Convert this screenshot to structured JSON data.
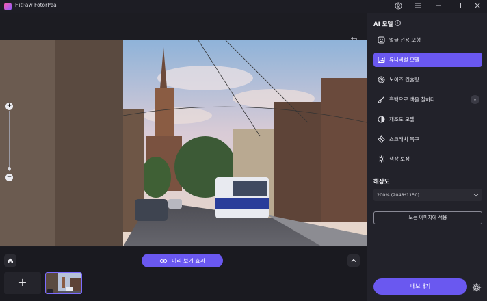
{
  "app": {
    "title": "HitPaw FotorPea"
  },
  "panel": {
    "title": "AI 모델",
    "models": [
      {
        "label": "얼굴 전용 모형",
        "icon": "face-icon",
        "active": false
      },
      {
        "label": "유니버설 모델",
        "icon": "image-icon",
        "active": true
      },
      {
        "label": "노이즈 컨슐링",
        "icon": "denoise-icon",
        "active": false
      },
      {
        "label": "흑백으로 색을 칠하다",
        "icon": "brush-icon",
        "active": false
      },
      {
        "label": "재조도 모델",
        "icon": "contrast-icon",
        "active": false
      },
      {
        "label": "스크래치 복구",
        "icon": "scratch-icon",
        "active": false
      },
      {
        "label": "색상 보정",
        "icon": "sun-icon",
        "active": false
      }
    ],
    "resolution_title": "해상도",
    "resolution_value": "200% (2048*1150)",
    "apply_all_label": "모든 이미지에 적용",
    "export_label": "내보내기"
  },
  "bottom": {
    "preview_label": "미리 보기 효과"
  },
  "colors": {
    "accent": "#6a58f0",
    "panel_bg": "#22222a",
    "app_bg": "#1c1c22"
  }
}
